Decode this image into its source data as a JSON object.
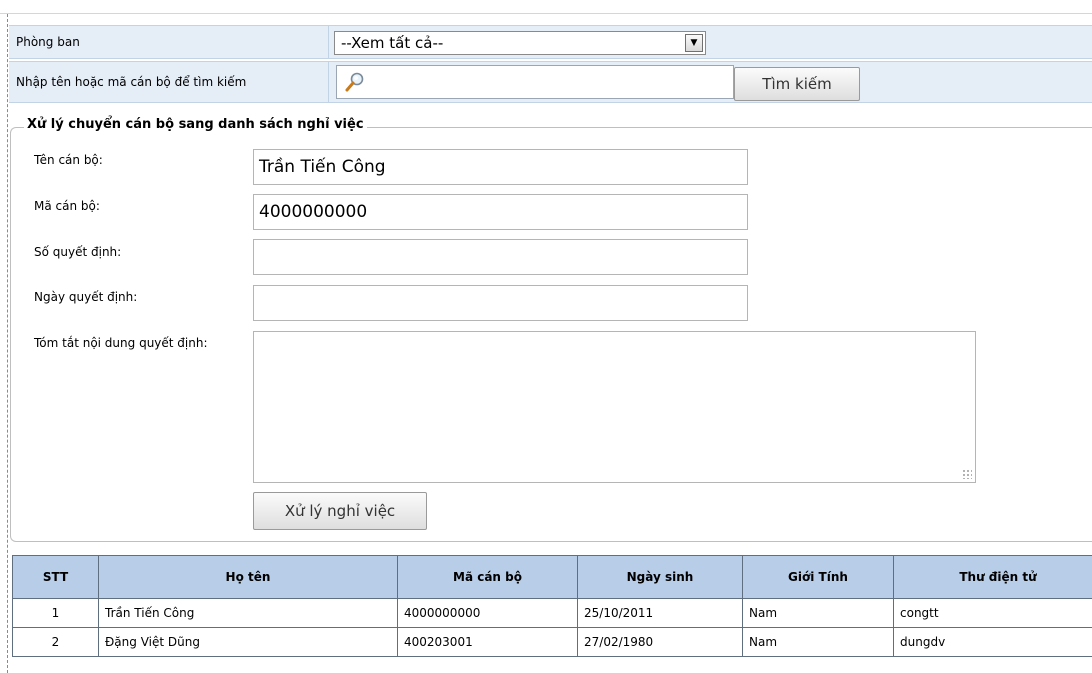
{
  "filter": {
    "department_label": "Phòng ban",
    "department_selected": "--Xem tất cả--",
    "search_label": "Nhập tên hoặc mã cán bộ để tìm kiếm",
    "search_value": "",
    "search_button": "Tìm kiếm"
  },
  "form": {
    "legend": "Xử lý chuyển cán bộ sang danh sách nghỉ việc",
    "name_label": "Tên cán bộ:",
    "name_value": "Trần Tiến Công",
    "code_label": "Mã cán bộ:",
    "code_value": "4000000000",
    "decision_no_label": "Số quyết định:",
    "decision_no_value": "",
    "decision_date_label": "Ngày quyết định:",
    "decision_date_value": "",
    "summary_label": "Tóm tắt nội dung quyết định:",
    "summary_value": "",
    "submit_button": "Xử lý nghỉ việc"
  },
  "table": {
    "headers": [
      "STT",
      "Họ tên",
      "Mã cán bộ",
      "Ngày sinh",
      "Giới Tính",
      "Thư điện tử"
    ],
    "rows": [
      [
        "1",
        "Trần Tiến Công",
        "4000000000",
        "25/10/2011",
        "Nam",
        "congtt"
      ],
      [
        "2",
        "Đặng Việt Dũng",
        "400203001",
        "27/02/1980",
        "Nam",
        "dungdv"
      ]
    ]
  },
  "icons": {
    "search": "magnifier-icon",
    "dropdown": "chevron-down-icon",
    "resize": "resize-grip-icon"
  },
  "colors": {
    "filter_row_bg": "#e5edf7",
    "table_header_bg": "#b7cde8"
  }
}
